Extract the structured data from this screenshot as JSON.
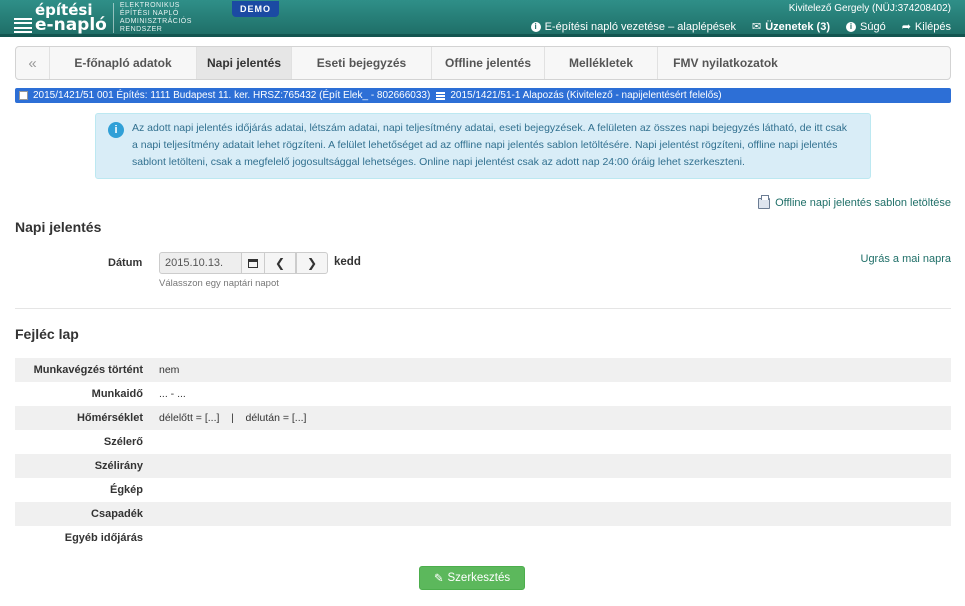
{
  "header": {
    "logo_line1": "építési",
    "logo_line2": "e-napló",
    "logo_sub1": "ELEKTRONIKUS",
    "logo_sub2": "ÉPÍTÉSI NAPLÓ",
    "logo_sub3": "ADMINISZTRÁCIÓS",
    "logo_sub4": "RENDSZER",
    "demo_badge": "DEMO",
    "user": "Kivitelező Gergely (NÜJ:374208402)",
    "nav": {
      "guide": "E-építési napló vezetése – alaplépések",
      "messages": "Üzenetek (3)",
      "help": "Súgó",
      "logout": "Kilépés"
    }
  },
  "tabs": {
    "back": "«",
    "items": [
      "E-főnapló adatok",
      "Napi jelentés",
      "Eseti bejegyzés",
      "Offline jelentés",
      "Mellékletek",
      "FMV nyilatkozatok"
    ],
    "active": "Napi jelentés"
  },
  "context_bar": {
    "main": "2015/1421/51 001 Építés: 1111 Budapest 11. ker. HRSZ:765432 (Épít Elek_ - 802666033)",
    "sub": "2015/1421/51-1 Alapozás (Kivitelező - napijelentésért felelős)"
  },
  "info_text": "Az adott napi jelentés időjárás adatai, létszám adatai, napi teljesítmény adatai, eseti bejegyzések. A felületen az összes napi bejegyzés látható, de itt csak a napi teljesítmény adatait lehet rögzíteni. A felület lehetőséget ad az offline napi jelentés sablon letöltésére. Napi jelentést rögzíteni, offline napi jelentés sablont letölteni, csak a megfelelő jogosultsággal lehetséges. Online napi jelentést csak az adott nap 24:00 óráig lehet szerkeszteni.",
  "download_link": "Offline napi jelentés sablon letöltése",
  "napi": {
    "title": "Napi jelentés",
    "date_label": "Dátum",
    "date_value": "2015.10.13.",
    "day_name": "kedd",
    "help": "Válasszon egy naptári napot",
    "today_link": "Ugrás a mai napra"
  },
  "fejlec": {
    "title": "Fejléc lap",
    "rows": [
      {
        "label": "Munkavégzés történt",
        "value": "nem"
      },
      {
        "label": "Munkaidő",
        "value": "... - ..."
      },
      {
        "label": "Hőmérséklet",
        "value": "délelőtt = [...]    |    délután = [...]"
      },
      {
        "label": "Szélerő",
        "value": ""
      },
      {
        "label": "Szélirány",
        "value": ""
      },
      {
        "label": "Égkép",
        "value": ""
      },
      {
        "label": "Csapadék",
        "value": ""
      },
      {
        "label": "Egyéb időjárás",
        "value": ""
      }
    ]
  },
  "edit_button": "Szerkesztés",
  "colors": {
    "header": "#1f6f68",
    "context_bar": "#2d6fd6",
    "info_bg": "#d9edf7",
    "edit_button": "#5cb85c"
  }
}
